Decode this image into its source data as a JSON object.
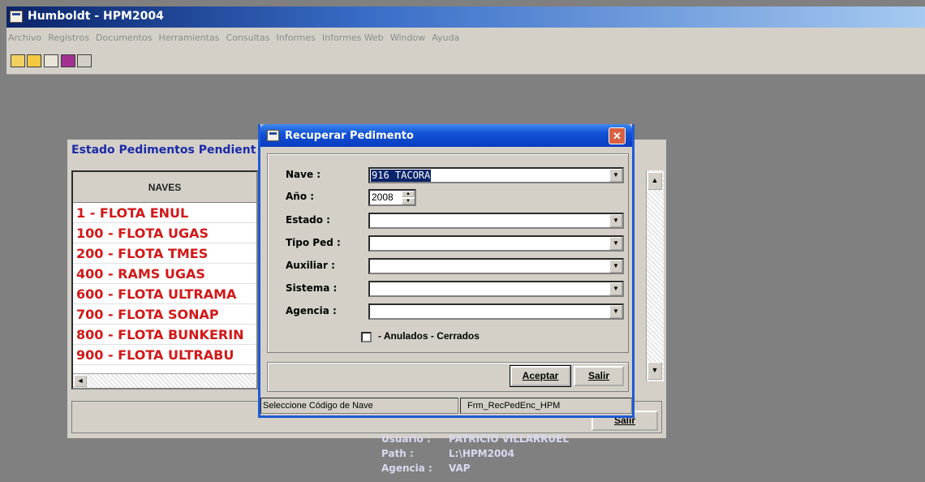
{
  "window": {
    "title": "Humboldt - HPM2004"
  },
  "menu": [
    "Archivo",
    "Registros",
    "Documentos",
    "Herramientas",
    "Consultas",
    "Informes",
    "Informes Web",
    "Window",
    "Ayuda"
  ],
  "toolbar": {
    "icons": [
      "open-icon",
      "folder-icon",
      "table-icon",
      "calendar-icon",
      "exit-icon"
    ]
  },
  "estado": {
    "title": "Estado Pedimentos Pendient",
    "column_header": "NAVES",
    "rows": [
      "1 - FLOTA ENUL",
      "100 - FLOTA UGAS",
      "200 - FLOTA TMES",
      "400 - RAMS UGAS",
      "600 - FLOTA ULTRAMA",
      "700 - FLOTA SONAP",
      "800 - FLOTA BUNKERIN",
      "900 - FLOTA ULTRABU"
    ],
    "salir_label": "Salir"
  },
  "user_info": {
    "usuario_label": "Usuario :",
    "usuario_value": "PATRICIO VILLARRUEL",
    "path_label": "Path :",
    "path_value": "L:\\HPM2004",
    "agencia_label": "Agencia :",
    "agencia_value": "VAP"
  },
  "dialog": {
    "title": "Recuperar Pedimento",
    "fields": {
      "nave_label": "Nave :",
      "nave_value": "916 TACORA",
      "ano_label": "Año :",
      "ano_value": "2008",
      "estado_label": "Estado :",
      "estado_value": "",
      "tipo_ped_label": "Tipo Ped :",
      "tipo_ped_value": "",
      "auxiliar_label": "Auxiliar :",
      "auxiliar_value": "",
      "sistema_label": "Sistema :",
      "sistema_value": "",
      "agencia_label": "Agencia :",
      "agencia_value": ""
    },
    "checkbox_label": "- Anulados - Cerrados",
    "checkbox_checked": false,
    "aceptar_label": "Aceptar",
    "salir_label": "Salir",
    "status_left": "Seleccione Código de Nave",
    "status_right": "Frm_RecPedEnc_HPM"
  }
}
